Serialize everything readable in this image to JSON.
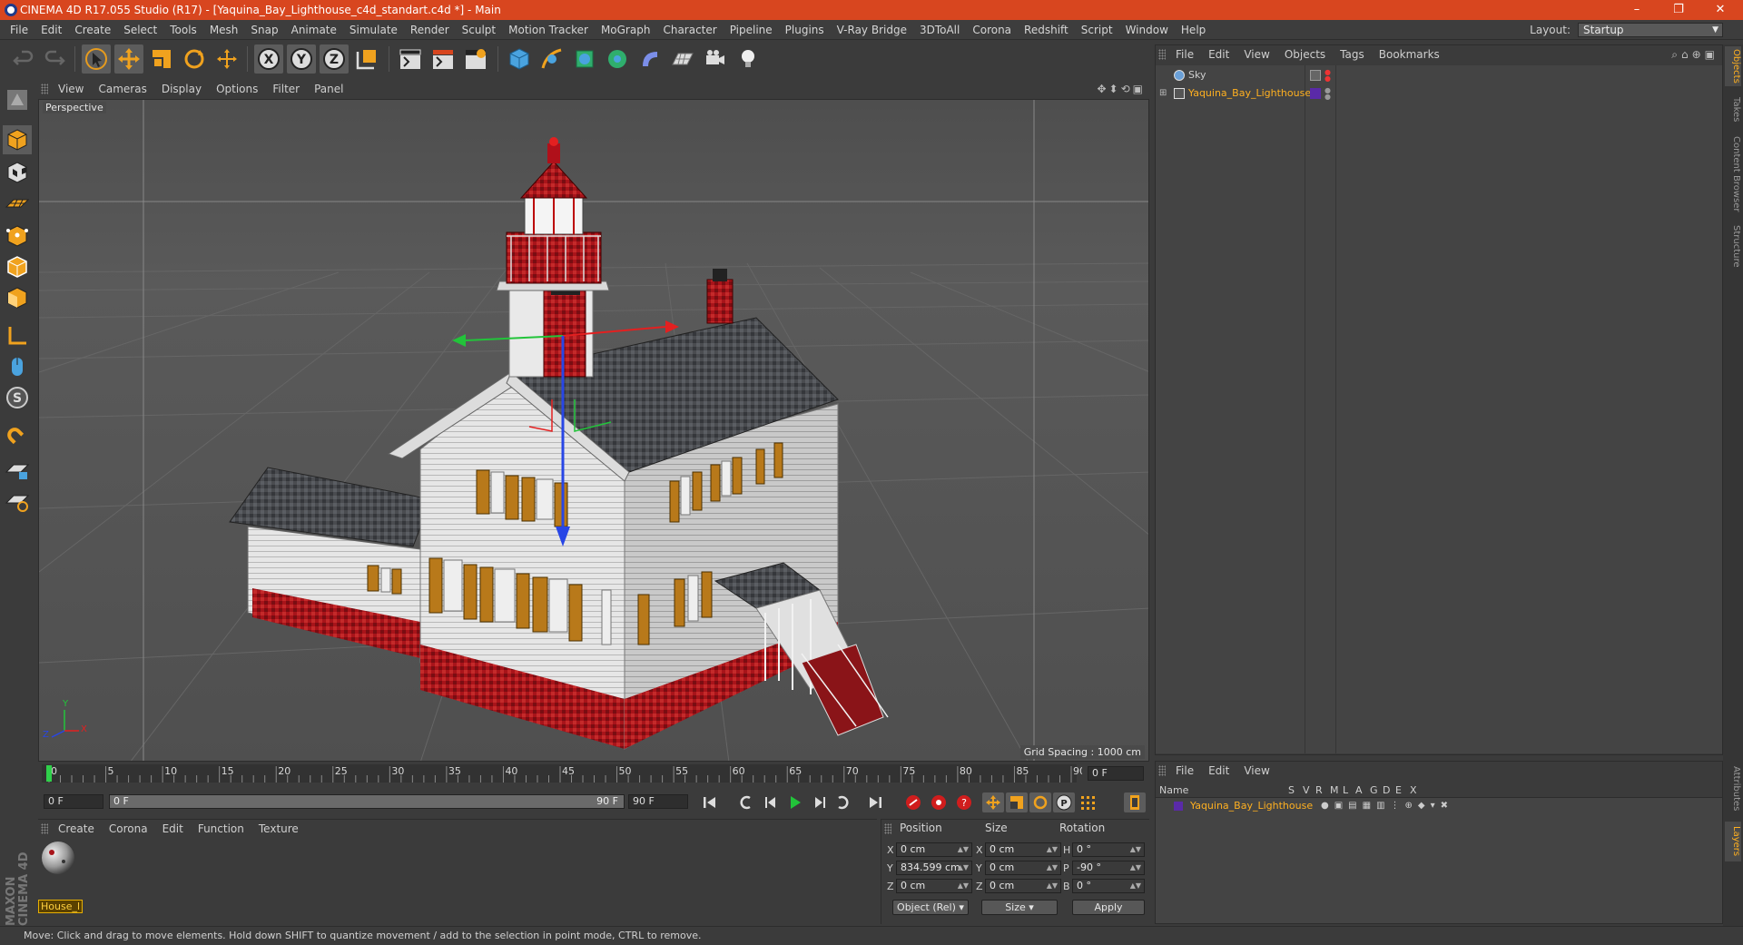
{
  "window": {
    "title": "CINEMA 4D R17.055 Studio (R17) - [Yaquina_Bay_Lighthouse_c4d_standart.c4d *] - Main",
    "controls": [
      "–",
      "❐",
      "✕"
    ]
  },
  "menubar": {
    "items": [
      "File",
      "Edit",
      "Create",
      "Select",
      "Tools",
      "Mesh",
      "Snap",
      "Animate",
      "Simulate",
      "Render",
      "Sculpt",
      "Motion Tracker",
      "MoGraph",
      "Character",
      "Pipeline",
      "Plugins",
      "V-Ray Bridge",
      "3DToAll",
      "Corona",
      "Redshift",
      "Script",
      "Window",
      "Help"
    ],
    "layout_label": "Layout:",
    "layout_value": "Startup"
  },
  "viewport": {
    "menu": [
      "View",
      "Cameras",
      "Display",
      "Options",
      "Filter",
      "Panel"
    ],
    "camera_label": "Perspective",
    "grid_spacing": "Grid Spacing : 1000 cm",
    "axis_labels": {
      "x": "X",
      "y": "Y",
      "z": "Z"
    }
  },
  "timeline": {
    "ticks": [
      "0",
      "5",
      "10",
      "15",
      "20",
      "25",
      "30",
      "35",
      "40",
      "45",
      "50",
      "55",
      "60",
      "65",
      "70",
      "75",
      "80",
      "85",
      "90"
    ],
    "current_frame": "0 F"
  },
  "transport": {
    "start_frame": "0 F",
    "slider_left": "0 F",
    "slider_right": "90 F",
    "end_frame": "90 F"
  },
  "material_manager": {
    "menu": [
      "Create",
      "Corona",
      "Edit",
      "Function",
      "Texture"
    ],
    "materials": [
      {
        "name": "House_l"
      }
    ]
  },
  "coordinates": {
    "headers": [
      "Position",
      "Size",
      "Rotation"
    ],
    "position": [
      {
        "axis": "X",
        "value": "0 cm"
      },
      {
        "axis": "Y",
        "value": "834.599 cm"
      },
      {
        "axis": "Z",
        "value": "0 cm"
      }
    ],
    "size": [
      {
        "axis": "X",
        "value": "0 cm"
      },
      {
        "axis": "Y",
        "value": "0 cm"
      },
      {
        "axis": "Z",
        "value": "0 cm"
      }
    ],
    "rotation": [
      {
        "axis": "H",
        "value": "0 °"
      },
      {
        "axis": "P",
        "value": "-90 °"
      },
      {
        "axis": "B",
        "value": "0 °"
      }
    ],
    "mode_dropdown": "Object (Rel)",
    "size_dropdown": "Size",
    "apply_label": "Apply"
  },
  "object_manager": {
    "menu": [
      "File",
      "Edit",
      "View",
      "Objects",
      "Tags",
      "Bookmarks"
    ],
    "objects": [
      {
        "name": "Sky",
        "color": "#cfcfcf"
      },
      {
        "name": "Yaquina_Bay_Lighthouse",
        "color": "#ffb020"
      }
    ]
  },
  "layer_manager": {
    "menu": [
      "File",
      "Edit",
      "View"
    ],
    "columns": [
      "Name",
      "S",
      "V",
      "R",
      "M",
      "L",
      "A",
      "G",
      "D",
      "E",
      "X"
    ],
    "layers": [
      {
        "name": "Yaquina_Bay_Lighthouse",
        "color": "#ffb020"
      }
    ]
  },
  "right_tabs": [
    "Objects",
    "Takes",
    "Content Browser",
    "Structure",
    "Attributes",
    "Layers"
  ],
  "status": "Move: Click and drag to move elements. Hold down SHIFT to quantize movement / add to the selection in point mode, CTRL to remove.",
  "colors": {
    "titlebar": "#d8461f",
    "accent": "#ffb020",
    "selected_tool": "#5c5c5c"
  }
}
